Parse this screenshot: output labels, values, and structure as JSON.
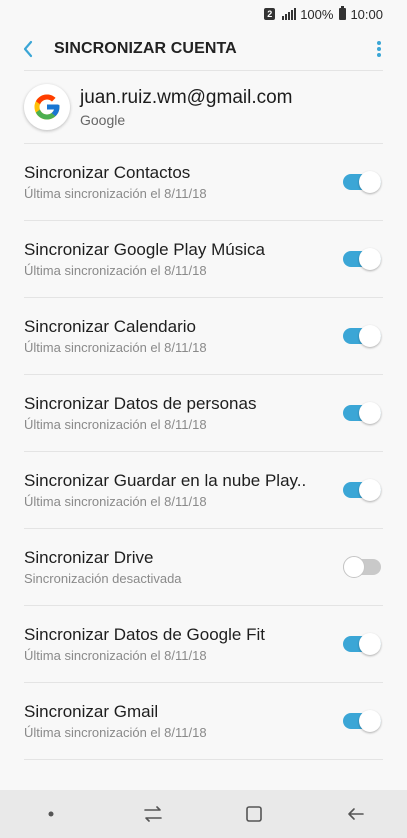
{
  "status_bar": {
    "sim_badge": "2",
    "battery": "100%",
    "time": "10:00"
  },
  "app_bar": {
    "title": "SINCRONIZAR CUENTA"
  },
  "account": {
    "email": "juan.ruiz.wm@gmail.com",
    "provider": "Google"
  },
  "sync_items": [
    {
      "title": "Sincronizar Contactos",
      "subtitle": "Última sincronización el 8/11/18",
      "enabled": true
    },
    {
      "title": "Sincronizar Google Play Música",
      "subtitle": "Última sincronización el 8/11/18",
      "enabled": true
    },
    {
      "title": "Sincronizar Calendario",
      "subtitle": "Última sincronización el 8/11/18",
      "enabled": true
    },
    {
      "title": "Sincronizar Datos de personas",
      "subtitle": "Última sincronización el 8/11/18",
      "enabled": true
    },
    {
      "title": "Sincronizar Guardar en la nube Play..",
      "subtitle": "Última sincronización el 8/11/18",
      "enabled": true
    },
    {
      "title": "Sincronizar Drive",
      "subtitle": "Sincronización desactivada",
      "enabled": false
    },
    {
      "title": "Sincronizar Datos de Google Fit",
      "subtitle": "Última sincronización el 8/11/18",
      "enabled": true
    },
    {
      "title": "Sincronizar Gmail",
      "subtitle": "Última sincronización el 8/11/18",
      "enabled": true
    }
  ],
  "colors": {
    "accent": "#3ba6d6",
    "switch_off": "#c9c9c9",
    "background": "#f8f8f8"
  }
}
